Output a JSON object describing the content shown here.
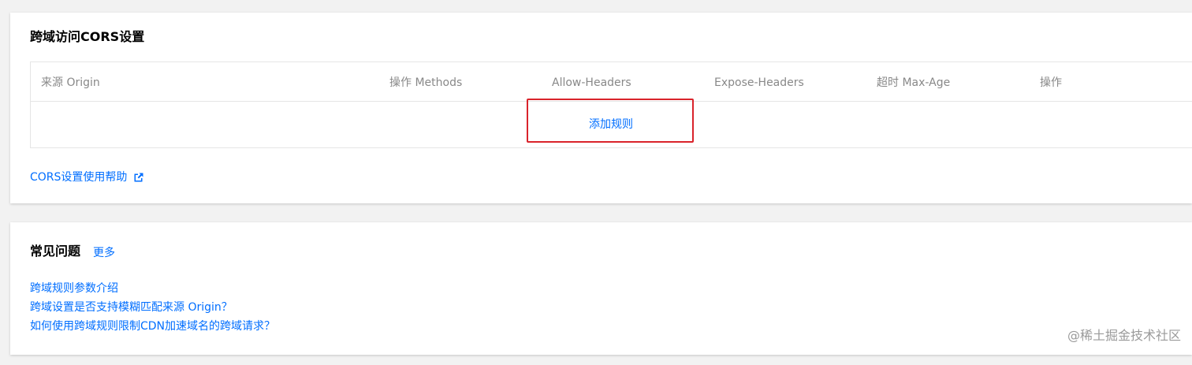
{
  "cors_section": {
    "title": "跨域访问CORS设置",
    "columns": [
      "来源 Origin",
      "操作 Methods",
      "Allow-Headers",
      "Expose-Headers",
      "超时 Max-Age",
      "操作"
    ],
    "add_rule_label": "添加规则",
    "help_link_label": "CORS设置使用帮助",
    "help_icon": "external-link-icon"
  },
  "faq_section": {
    "title": "常见问题",
    "more_label": "更多",
    "items": [
      "跨域规则参数介绍",
      "跨域设置是否支持模糊匹配来源 Origin？",
      "如何使用跨域规则限制CDN加速域名的跨域请求？"
    ]
  },
  "watermark": "@稀土掘金技术社区",
  "colors": {
    "link": "#006eff",
    "highlight_border": "#d9232b",
    "header_text": "#888888",
    "page_background": "#f2f2f2"
  }
}
